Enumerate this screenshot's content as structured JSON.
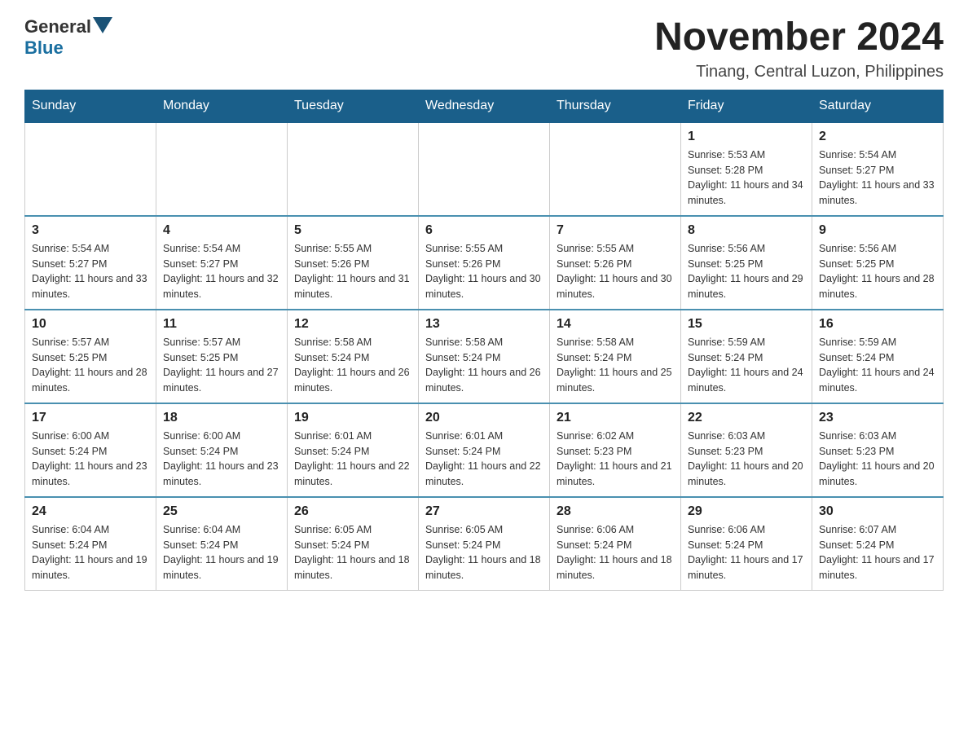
{
  "header": {
    "logo": {
      "general": "General",
      "blue": "Blue"
    },
    "title": "November 2024",
    "location": "Tinang, Central Luzon, Philippines"
  },
  "days_of_week": [
    "Sunday",
    "Monday",
    "Tuesday",
    "Wednesday",
    "Thursday",
    "Friday",
    "Saturday"
  ],
  "weeks": [
    [
      {
        "day": "",
        "info": ""
      },
      {
        "day": "",
        "info": ""
      },
      {
        "day": "",
        "info": ""
      },
      {
        "day": "",
        "info": ""
      },
      {
        "day": "",
        "info": ""
      },
      {
        "day": "1",
        "info": "Sunrise: 5:53 AM\nSunset: 5:28 PM\nDaylight: 11 hours and 34 minutes."
      },
      {
        "day": "2",
        "info": "Sunrise: 5:54 AM\nSunset: 5:27 PM\nDaylight: 11 hours and 33 minutes."
      }
    ],
    [
      {
        "day": "3",
        "info": "Sunrise: 5:54 AM\nSunset: 5:27 PM\nDaylight: 11 hours and 33 minutes."
      },
      {
        "day": "4",
        "info": "Sunrise: 5:54 AM\nSunset: 5:27 PM\nDaylight: 11 hours and 32 minutes."
      },
      {
        "day": "5",
        "info": "Sunrise: 5:55 AM\nSunset: 5:26 PM\nDaylight: 11 hours and 31 minutes."
      },
      {
        "day": "6",
        "info": "Sunrise: 5:55 AM\nSunset: 5:26 PM\nDaylight: 11 hours and 30 minutes."
      },
      {
        "day": "7",
        "info": "Sunrise: 5:55 AM\nSunset: 5:26 PM\nDaylight: 11 hours and 30 minutes."
      },
      {
        "day": "8",
        "info": "Sunrise: 5:56 AM\nSunset: 5:25 PM\nDaylight: 11 hours and 29 minutes."
      },
      {
        "day": "9",
        "info": "Sunrise: 5:56 AM\nSunset: 5:25 PM\nDaylight: 11 hours and 28 minutes."
      }
    ],
    [
      {
        "day": "10",
        "info": "Sunrise: 5:57 AM\nSunset: 5:25 PM\nDaylight: 11 hours and 28 minutes."
      },
      {
        "day": "11",
        "info": "Sunrise: 5:57 AM\nSunset: 5:25 PM\nDaylight: 11 hours and 27 minutes."
      },
      {
        "day": "12",
        "info": "Sunrise: 5:58 AM\nSunset: 5:24 PM\nDaylight: 11 hours and 26 minutes."
      },
      {
        "day": "13",
        "info": "Sunrise: 5:58 AM\nSunset: 5:24 PM\nDaylight: 11 hours and 26 minutes."
      },
      {
        "day": "14",
        "info": "Sunrise: 5:58 AM\nSunset: 5:24 PM\nDaylight: 11 hours and 25 minutes."
      },
      {
        "day": "15",
        "info": "Sunrise: 5:59 AM\nSunset: 5:24 PM\nDaylight: 11 hours and 24 minutes."
      },
      {
        "day": "16",
        "info": "Sunrise: 5:59 AM\nSunset: 5:24 PM\nDaylight: 11 hours and 24 minutes."
      }
    ],
    [
      {
        "day": "17",
        "info": "Sunrise: 6:00 AM\nSunset: 5:24 PM\nDaylight: 11 hours and 23 minutes."
      },
      {
        "day": "18",
        "info": "Sunrise: 6:00 AM\nSunset: 5:24 PM\nDaylight: 11 hours and 23 minutes."
      },
      {
        "day": "19",
        "info": "Sunrise: 6:01 AM\nSunset: 5:24 PM\nDaylight: 11 hours and 22 minutes."
      },
      {
        "day": "20",
        "info": "Sunrise: 6:01 AM\nSunset: 5:24 PM\nDaylight: 11 hours and 22 minutes."
      },
      {
        "day": "21",
        "info": "Sunrise: 6:02 AM\nSunset: 5:23 PM\nDaylight: 11 hours and 21 minutes."
      },
      {
        "day": "22",
        "info": "Sunrise: 6:03 AM\nSunset: 5:23 PM\nDaylight: 11 hours and 20 minutes."
      },
      {
        "day": "23",
        "info": "Sunrise: 6:03 AM\nSunset: 5:23 PM\nDaylight: 11 hours and 20 minutes."
      }
    ],
    [
      {
        "day": "24",
        "info": "Sunrise: 6:04 AM\nSunset: 5:24 PM\nDaylight: 11 hours and 19 minutes."
      },
      {
        "day": "25",
        "info": "Sunrise: 6:04 AM\nSunset: 5:24 PM\nDaylight: 11 hours and 19 minutes."
      },
      {
        "day": "26",
        "info": "Sunrise: 6:05 AM\nSunset: 5:24 PM\nDaylight: 11 hours and 18 minutes."
      },
      {
        "day": "27",
        "info": "Sunrise: 6:05 AM\nSunset: 5:24 PM\nDaylight: 11 hours and 18 minutes."
      },
      {
        "day": "28",
        "info": "Sunrise: 6:06 AM\nSunset: 5:24 PM\nDaylight: 11 hours and 18 minutes."
      },
      {
        "day": "29",
        "info": "Sunrise: 6:06 AM\nSunset: 5:24 PM\nDaylight: 11 hours and 17 minutes."
      },
      {
        "day": "30",
        "info": "Sunrise: 6:07 AM\nSunset: 5:24 PM\nDaylight: 11 hours and 17 minutes."
      }
    ]
  ]
}
